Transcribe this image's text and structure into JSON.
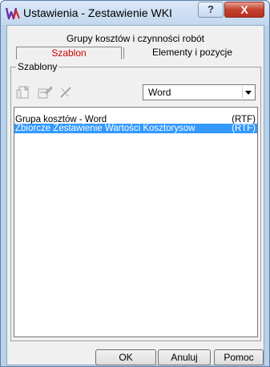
{
  "window": {
    "title": "Ustawienia - Zestawienie WKI",
    "help_label": "?",
    "close_label": "X"
  },
  "tabs": {
    "group_tab": "Grupy kosztów i czynności robót",
    "items": [
      {
        "label": "Szablon",
        "active": true
      },
      {
        "label": "Elementy i pozycje",
        "active": false
      }
    ]
  },
  "templates": {
    "group_label": "Szablony",
    "format_select": {
      "value": "Word"
    },
    "items": [
      {
        "name": "Grupa kosztów - Word",
        "ext": "(RTF)",
        "selected": false
      },
      {
        "name": "Zbiorcze Zestawienie Wartości Kosztorysow",
        "ext": "(RTF)",
        "selected": true
      }
    ]
  },
  "buttons": {
    "ok": "OK",
    "cancel": "Anuluj",
    "help": "Pomoc"
  },
  "colors": {
    "active_tab_text": "#cc0000",
    "selection": "#3399ff",
    "close_button": "#c2412f"
  }
}
